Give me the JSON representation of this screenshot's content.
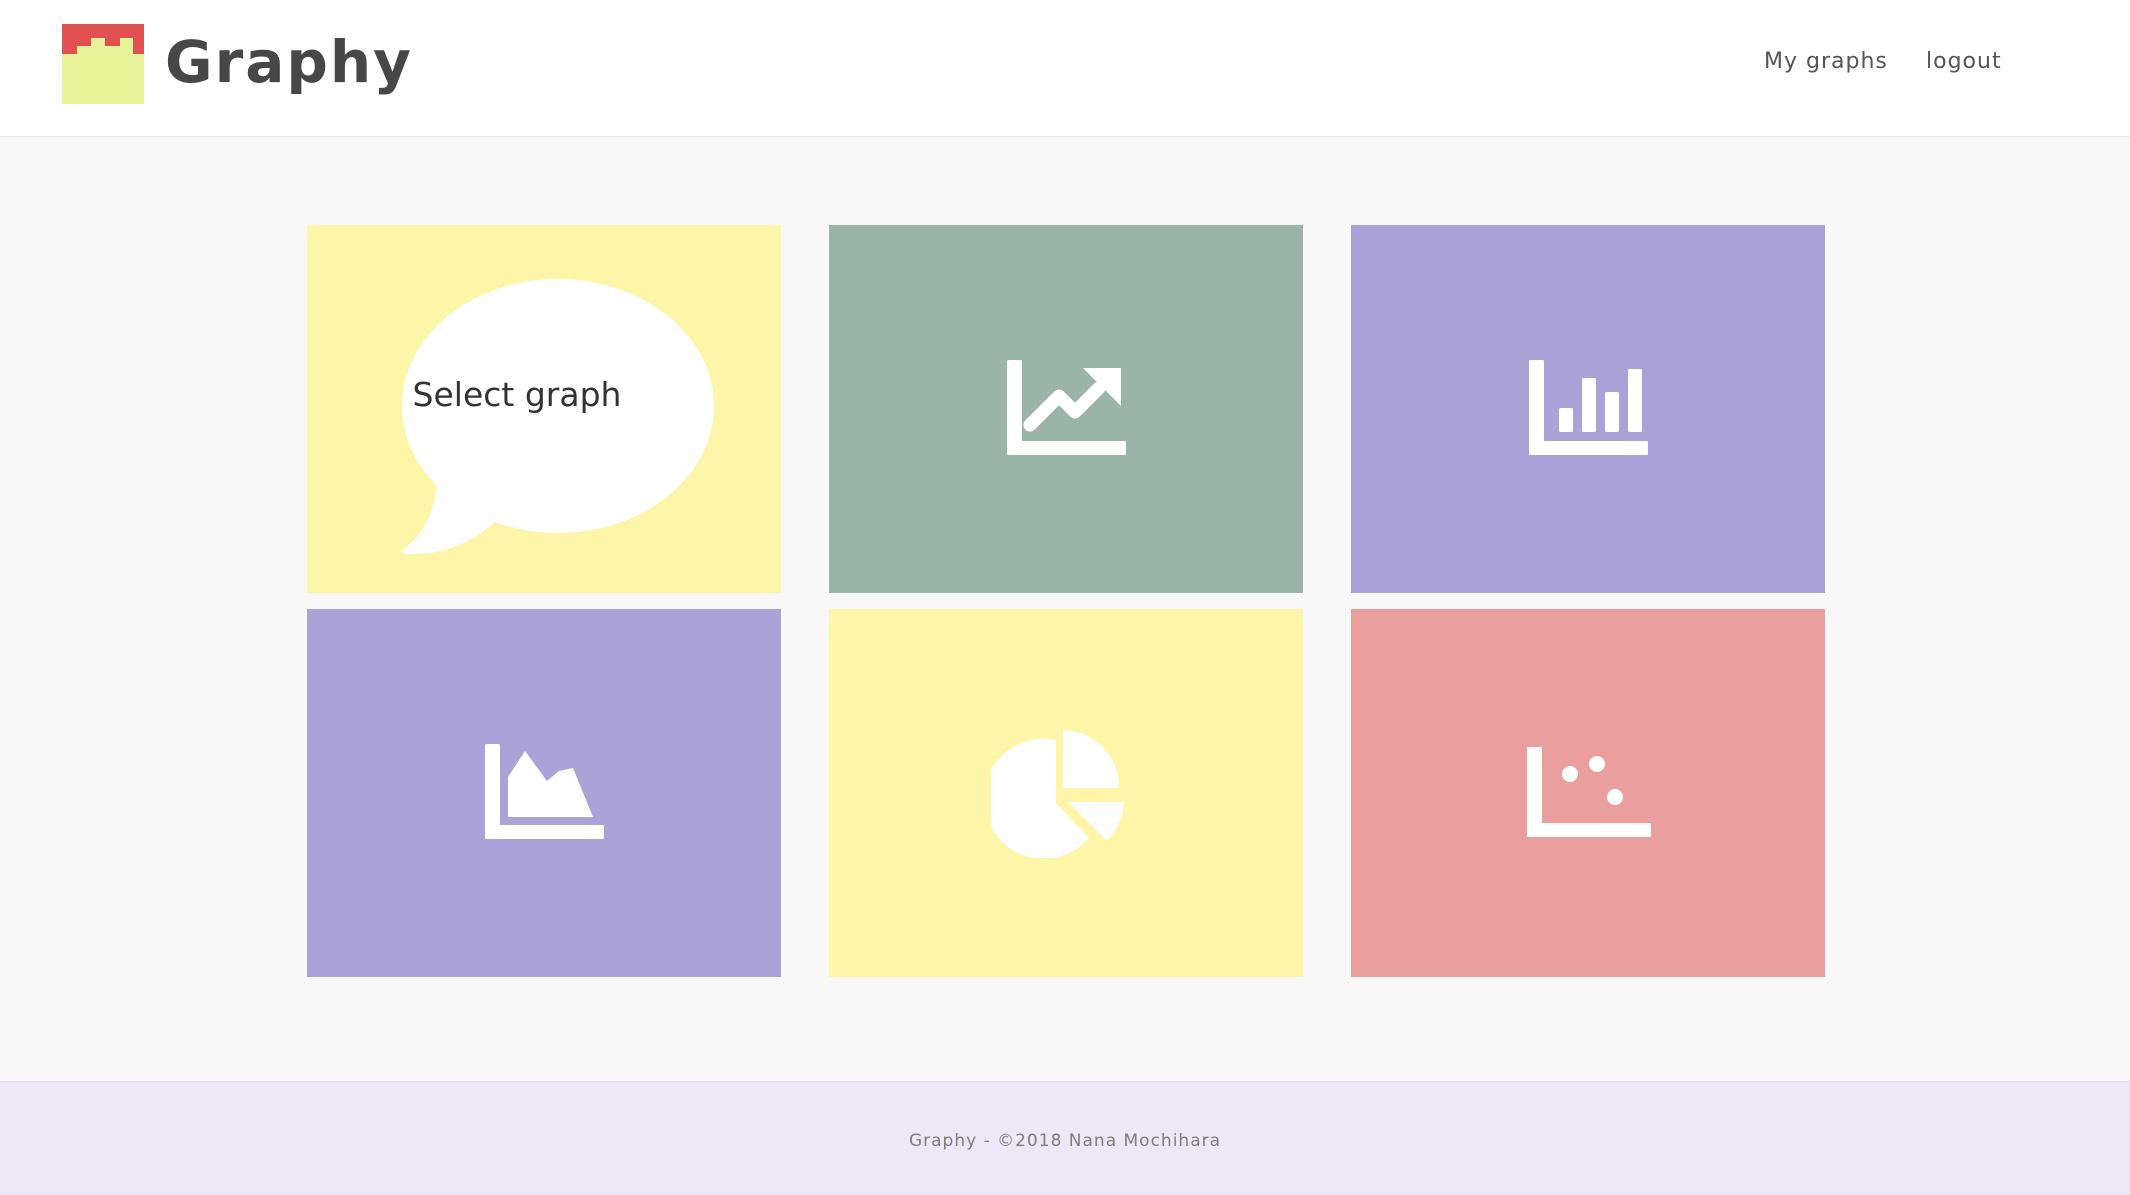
{
  "header": {
    "brand": "Graphy",
    "nav": {
      "my_graphs": "My graphs",
      "logout": "logout"
    }
  },
  "colors": {
    "logo_top": "#e15151",
    "logo_bottom": "#e8f39a",
    "yellow": "#fdf5a7",
    "teal": "#9bb4aa",
    "purple": "#aba3d8",
    "pink": "#ea9f9e",
    "footer_bg": "#ece8f8"
  },
  "main": {
    "select_prompt": "Select graph",
    "tiles": [
      {
        "icon": "speech-bubble-icon",
        "color": "yellow"
      },
      {
        "icon": "line-chart-icon",
        "color": "teal"
      },
      {
        "icon": "bar-chart-icon",
        "color": "purple"
      },
      {
        "icon": "area-chart-icon",
        "color": "purple"
      },
      {
        "icon": "pie-chart-icon",
        "color": "yellow"
      },
      {
        "icon": "scatter-chart-icon",
        "color": "pink"
      }
    ]
  },
  "footer": {
    "text": "Graphy - ©2018 Nana Mochihara"
  }
}
